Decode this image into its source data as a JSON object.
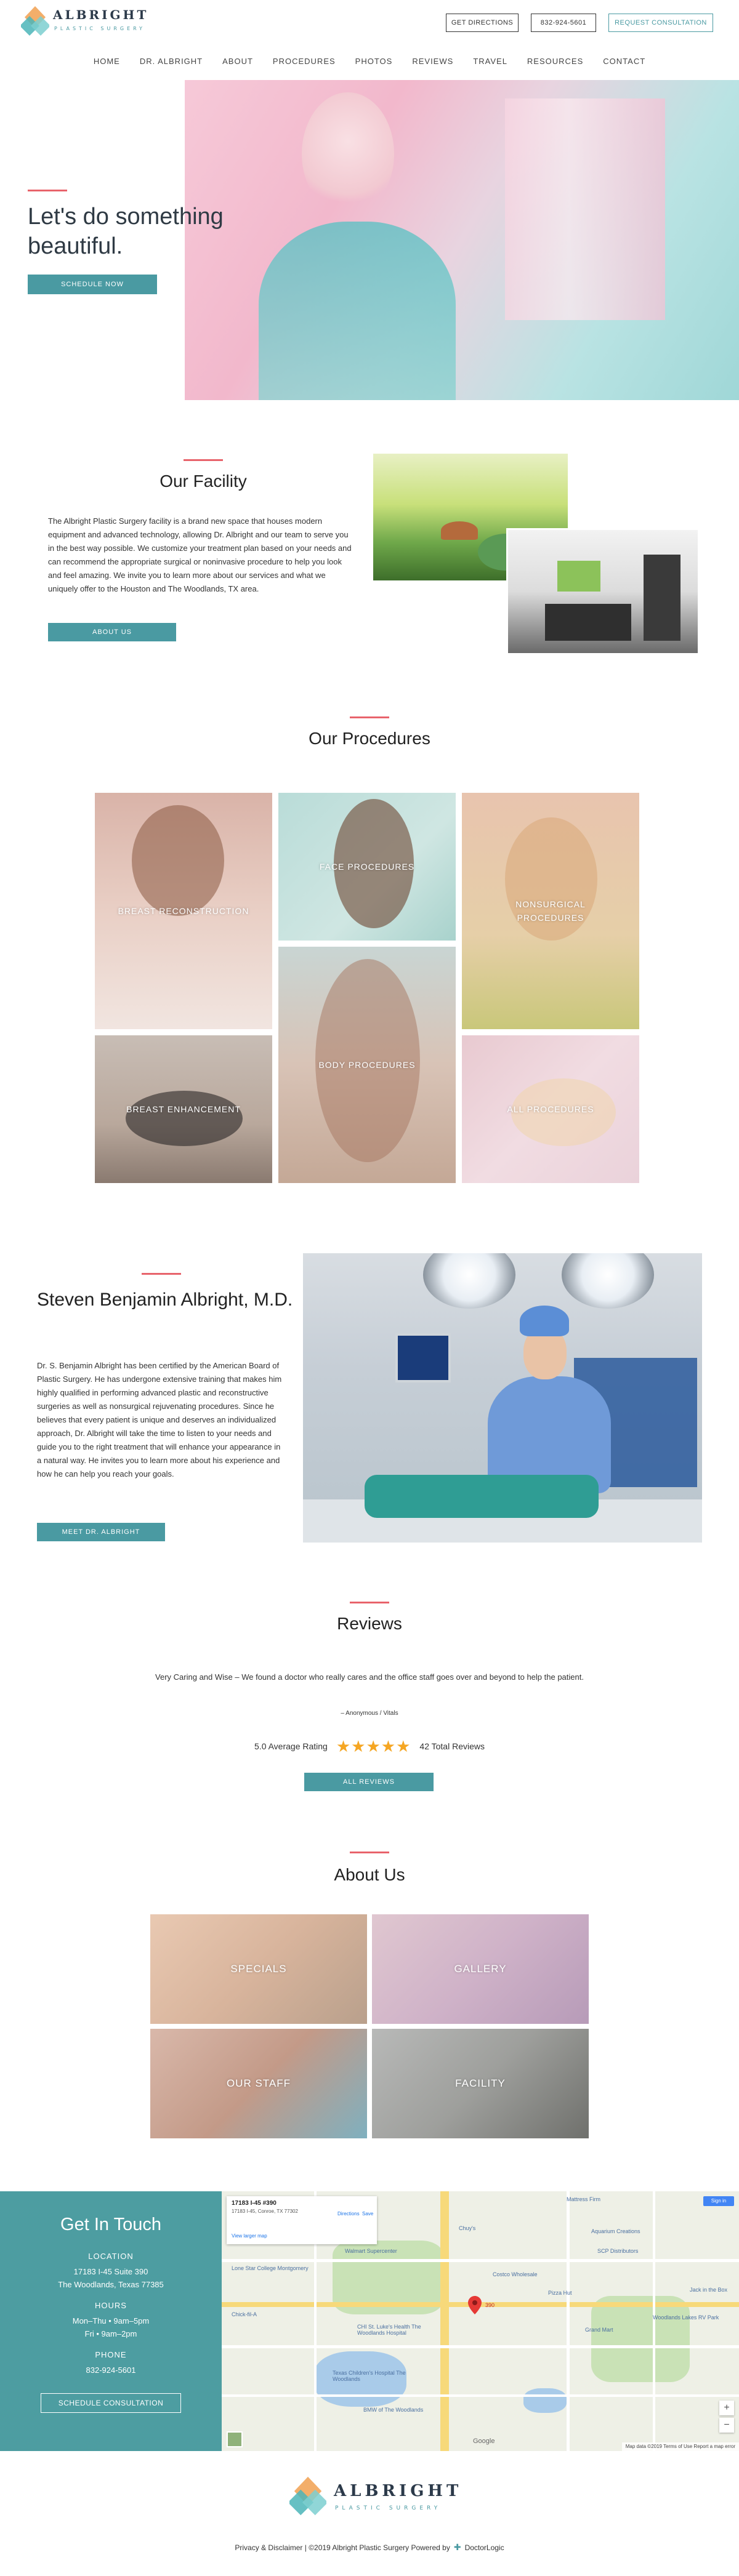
{
  "header": {
    "logo_name": "ALBRIGHT",
    "logo_sub": "PLASTIC SURGERY",
    "get_directions": "GET DIRECTIONS",
    "phone": "832-924-5601",
    "request_consultation": "REQUEST CONSULTATION"
  },
  "nav": {
    "items": [
      "HOME",
      "DR. ALBRIGHT",
      "ABOUT",
      "PROCEDURES",
      "PHOTOS",
      "REVIEWS",
      "TRAVEL",
      "RESOURCES",
      "CONTACT"
    ]
  },
  "hero": {
    "title": "Let's do something beautiful.",
    "cta": "SCHEDULE NOW"
  },
  "facility": {
    "title": "Our Facility",
    "body": "The Albright Plastic Surgery facility is a brand new space that houses modern equipment and advanced technology, allowing Dr. Albright and our team to serve you in the best way possible. We customize your treatment plan based on your needs and can recommend the appropriate surgical or noninvasive procedure to help you look and feel amazing. We invite you to learn more about our services and what we uniquely offer to the Houston and The Woodlands, TX area.",
    "cta": "ABOUT US"
  },
  "procedures": {
    "title": "Our Procedures",
    "tiles": [
      "BREAST RECONSTRUCTION",
      "FACE PROCEDURES",
      "NONSURGICAL PROCEDURES",
      "BODY PROCEDURES",
      "BREAST ENHANCEMENT",
      "ALL PROCEDURES"
    ]
  },
  "doctor": {
    "title": "Steven Benjamin Albright, M.D.",
    "body": "Dr. S. Benjamin Albright has been certified by the American Board of Plastic Surgery. He has undergone extensive training that makes him highly qualified in performing advanced plastic and reconstructive surgeries as well as nonsurgical rejuvenating procedures. Since he believes that every patient is unique and deserves an individualized approach, Dr. Albright will take the time to listen to your needs and guide you to the right treatment that will enhance your appearance in a natural way. He invites you to learn more about his experience and how he can help you reach your goals.",
    "cta": "MEET DR. ALBRIGHT"
  },
  "reviews": {
    "title": "Reviews",
    "quote": "Very Caring and Wise – We found a doctor who really cares and the office staff goes over and beyond to help the patient.",
    "author": "– Anonymous / Vitals",
    "average": "5.0 Average Rating",
    "stars": "★★★★★",
    "total": "42 Total Reviews",
    "cta": "ALL REVIEWS"
  },
  "about": {
    "title": "About Us",
    "tiles": [
      "SPECIALS",
      "GALLERY",
      "OUR STAFF",
      "FACILITY"
    ]
  },
  "contact": {
    "title": "Get In Touch",
    "location_head": "LOCATION",
    "address1": "17183 I-45 Suite 390",
    "address2": "The Woodlands, Texas 77385",
    "hours_head": "HOURS",
    "hours1": "Mon–Thu • 9am–5pm",
    "hours2": "Fri • 9am–2pm",
    "phone_head": "PHONE",
    "phone": "832-924-5601",
    "cta": "SCHEDULE CONSULTATION"
  },
  "map": {
    "card_title": "17183 I-45 #390",
    "card_addr": "17183 I-45, Conroe, TX 77302",
    "directions": "Directions",
    "save": "Save",
    "view_larger": "View larger map",
    "signin": "Sign in",
    "pin_label": "390",
    "footer": "Map data ©2019  Terms of Use  Report a map error",
    "google": "Google",
    "pois": [
      "Mattress Firm",
      "Lone Star College Montgomery",
      "Walmart Supercenter",
      "SCP Distributors",
      "Aquarium Creations",
      "Costco Wholesale",
      "CHI St. Luke's Health The Woodlands Hospital",
      "Texas Children's Hospital The Woodlands",
      "BMW of The Woodlands",
      "Pizza Hut",
      "Chick-fil-A",
      "Woodlands Lakes RV Park",
      "Jack in the Box",
      "Chuy's",
      "Grand Mart"
    ]
  },
  "footer": {
    "logo_name": "ALBRIGHT",
    "logo_sub": "PLASTIC SURGERY",
    "text": "Privacy & Disclaimer | ©2019 Albright Plastic Surgery Powered by",
    "brand": "DoctorLogic"
  },
  "colors": {
    "accent": "#e8636b",
    "teal": "#4a9aa2",
    "contact_bg": "#4d9da1",
    "stars": "#f5a623"
  }
}
